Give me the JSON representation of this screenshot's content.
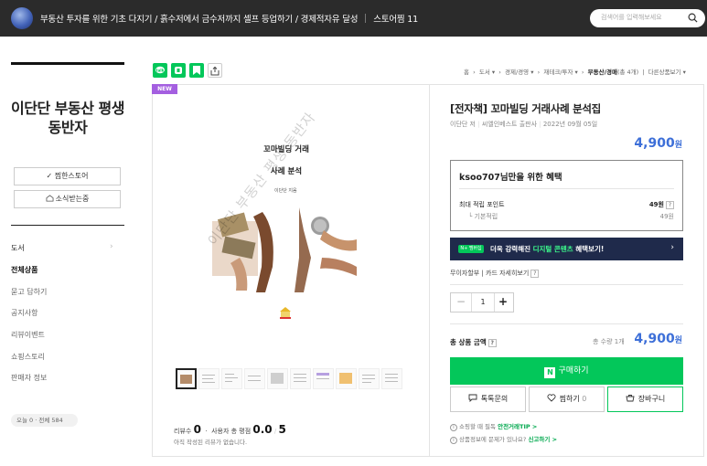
{
  "header": {
    "store_name": "부동산 투자를 위한 기초 다지기 / 흙수저에서 금수저까지 셀프 등업하기 / 경제적자유 달성",
    "store_zzim": "스토어찜 11",
    "search_placeholder": "검색어를 입력해보세요"
  },
  "sidebar": {
    "store_title": "이단단 부동산 평생 동반자",
    "zzim_button": "✓ 찜한스토어",
    "notify_button": "소식받는중",
    "nav": [
      "도서",
      "전체상품",
      "묻고 답하기",
      "공지사항",
      "리뷰이벤트",
      "쇼핑스토리",
      "판매자 정보"
    ],
    "visit_stats": "오늘 0 · 전체 584"
  },
  "breadcrumb": {
    "items": [
      "홈",
      "도서 ▾",
      "경제/경영 ▾",
      "재테크/투자 ▾"
    ],
    "current": "부동산/경매",
    "count": "(총 4개)",
    "more": "다른상품보기 ▾"
  },
  "badge": {
    "new": "NEW"
  },
  "cover": {
    "title_line1": "꼬마빌딩 거래",
    "title_line2": "사례 분석",
    "author": "이단단 지음",
    "watermark": "이단단 부동산 평생 동반자"
  },
  "review": {
    "label": "리뷰수",
    "count": "0",
    "rating_label": "사용자 총 평점",
    "rating": "0.0",
    "rating_max": "5",
    "empty_text": "아직 작성된 리뷰가 없습니다."
  },
  "product": {
    "title": "[전자책] 꼬마빌딩 거래사례 분석집",
    "author": "이단단 저",
    "publisher": "씨엘인베스트 출판사",
    "date": "2022년 09월 05일",
    "price": "4,900",
    "price_unit": "원"
  },
  "benefit": {
    "title": "ksoo707님만을 위한 혜택",
    "max_point_label": "최대 적립 포인트",
    "max_point": "49원",
    "base_label": "기본적립",
    "base_value": "49원"
  },
  "banner": {
    "badge": "N+ 멤버십",
    "text_before": "더욱 강력해진 ",
    "text_highlight": "디지털 콘텐츠",
    "text_after": " 혜택보기!"
  },
  "installment": "무이자할부 | 카드 자세히보기",
  "quantity": {
    "value": "1",
    "minus": "−",
    "plus": "+"
  },
  "total": {
    "label": "총 상품 금액",
    "qty_text": "총 수량 1개",
    "price": "4,900",
    "unit": "원"
  },
  "buttons": {
    "buy": "구매하기",
    "talk": "톡톡문의",
    "zzim": "찜하기",
    "zzim_count": "0",
    "cart": "장바구니"
  },
  "notices": {
    "safe_text": "쇼핑할 때 필독",
    "safe_link": "안전거래TIP >",
    "report_text": "상품정보에 문제가 있나요?",
    "report_link": "신고하기 >"
  },
  "colors": {
    "accent_green": "#03c75a",
    "price_blue": "#3d6fd8",
    "new_purple": "#a45fe0",
    "banner_navy": "#1f2a4b"
  }
}
